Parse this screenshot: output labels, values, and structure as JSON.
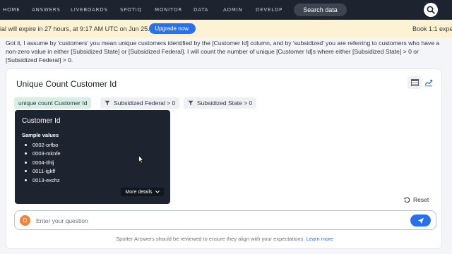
{
  "nav": {
    "items": [
      "HOME",
      "ANSWERS",
      "LIVEBOARDS",
      "SPOTIQ",
      "MONITOR",
      "DATA",
      "ADMIN",
      "DEVELOP"
    ],
    "search_label": "Search data"
  },
  "banner": {
    "text": "ial will expire in 27 hours, at 9:17 AM UTC on Jun 25.",
    "upgrade_label": "Upgrade now.",
    "right_text": "Book 1:1 exper"
  },
  "answer": {
    "text": "Got it, I assume by 'customers' you mean unique customers identified by the [Customer Id] column, and by 'subsidized' you are referring to customers who have a non-zero value in either [Subsidized State] or [Subsidized Federal]. I will count the number of unique [Customer Id]s where either [Subsidized State] > 0 or [Subsidized Federal] > 0."
  },
  "card": {
    "title": "Unique Count Customer Id",
    "chips": [
      "unique count Customer Id",
      "Subsidized Federal > 0",
      "Subsidized State > 0"
    ]
  },
  "popover": {
    "title": "Customer Id",
    "subtitle": "Sample values",
    "values": [
      "0002-orfbo",
      "0003-mknfe",
      "0004-tlhlj",
      "0011-igkff",
      "0013-exchz"
    ],
    "more_label": "More details"
  },
  "reset_label": "Reset",
  "input": {
    "avatar_letter": "D",
    "placeholder": "Enter your question"
  },
  "disclaimer": {
    "text": "Spotter Answers should be reviewed to ensure they align with your expectations.",
    "link": "Learn more"
  },
  "colors": {
    "nav_bg": "#1d232f",
    "accent": "#2770ef",
    "banner_bg": "#fdf3d4",
    "chip_green": "#d8f0e4",
    "avatar": "#f0833a"
  }
}
